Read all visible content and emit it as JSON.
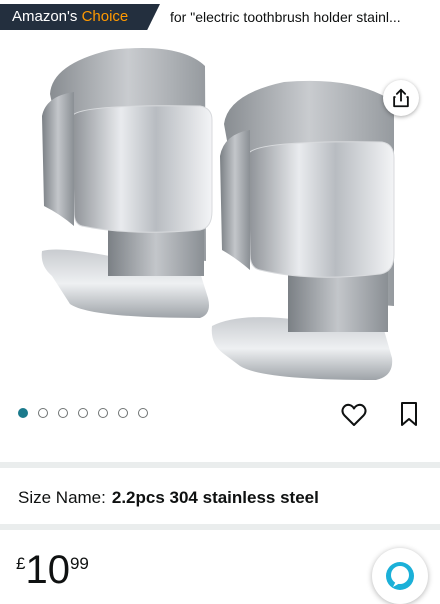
{
  "badge": {
    "prefix": "Amazon's ",
    "highlight": "Choice"
  },
  "search_context": "for \"electric toothbrush holder stainl...",
  "image_carousel": {
    "count": 7,
    "active_index": 0
  },
  "size": {
    "label": "Size Name:",
    "value": "2.2pcs 304 stainless steel"
  },
  "price": {
    "currency": "£",
    "whole": "10",
    "fraction": "99"
  },
  "colors": {
    "badge_bg": "#232f3e",
    "badge_highlight": "#ff9900",
    "active_dot": "#1b7a8c",
    "alexa": "#1bb0d8"
  }
}
